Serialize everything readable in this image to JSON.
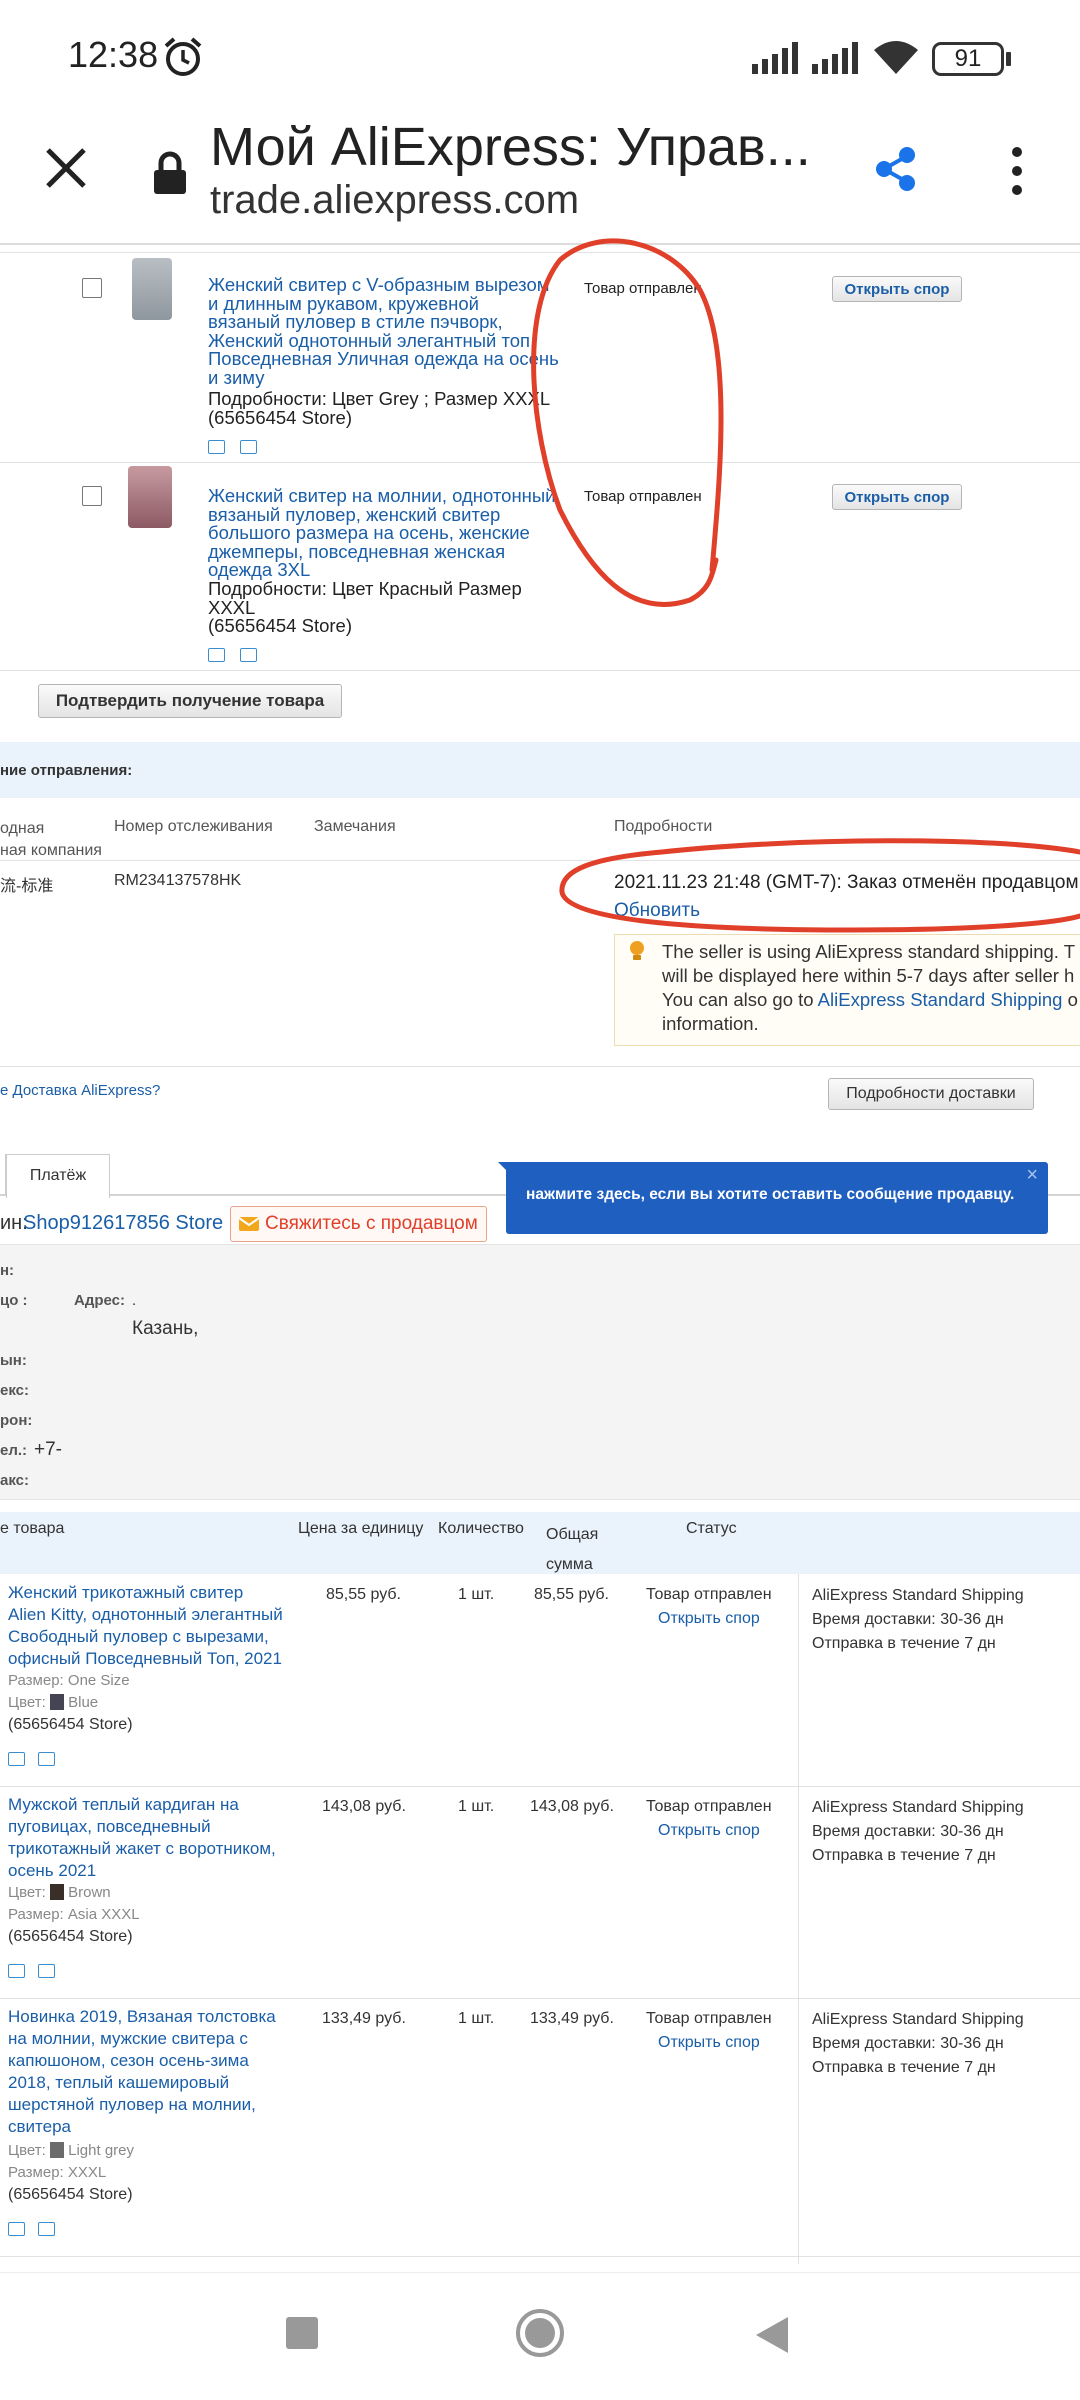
{
  "status_bar": {
    "time": "12:38",
    "battery": "91"
  },
  "browser": {
    "title": "Мой AliExpress: Управ...",
    "url": "trade.aliexpress.com"
  },
  "order_items_top": [
    {
      "title_lines": [
        "Женский свитер с V-образным вырезом",
        "и длинным рукавом, кружевной",
        "вязаный пуловер в стиле пэчворк,",
        "Женский однотонный элегантный топ,",
        "Повседневная Уличная одежда на осень",
        "и зиму"
      ],
      "details_lines": [
        "Подробности: Цвет Grey   ; Размер XXXL",
        "(65656454 Store)"
      ],
      "status": "Товар отправлен",
      "dispute": "Открыть спор"
    },
    {
      "title_lines": [
        "Женский свитер на молнии, однотонный",
        "вязаный пуловер, женский свитер",
        "большого размера на осень, женские",
        "джемперы, повседневная женская",
        "одежда 3XL"
      ],
      "details_lines": [
        "Подробности: Цвет Красный Размер",
        "XXXL",
        "(65656454 Store)"
      ],
      "status": "Товар отправлен",
      "dispute": "Открыть спор"
    }
  ],
  "confirm_button": "Подтвердить получение товара",
  "shipping": {
    "header": "ние отправления:",
    "col_company_1": "одная",
    "col_company_2": "ная компания",
    "col_tracking": "Номер отслеживания",
    "col_remarks": "Замечания",
    "col_details": "Подробности",
    "company": "流-标准",
    "tracking_number": "RM234137578HK",
    "event": "2021.11.23 21:48 (GMT-7): Заказ отменён продавцом",
    "refresh": "Обновить",
    "notice_lines": [
      "The seller is using AliExpress standard shipping. T",
      "will be displayed here within 5-7 days after seller h",
      "information."
    ],
    "notice_line3_pre": "You can also go to ",
    "notice_line3_link": "AliExpress Standard Shipping",
    "notice_line3_post": " o",
    "question_link": "е Доставка AliExpress?",
    "details_button": "Подробности доставки"
  },
  "tabs": {
    "payment": "Платёж"
  },
  "tooltip": {
    "text": "нажмите здесь, если вы хотите оставить сообщение продавцу.",
    "close": "×"
  },
  "store": {
    "label": "ин:",
    "name": "Shop912617856 Store",
    "contact": "Свяжитесь с продавцом"
  },
  "address": {
    "r1": "н:",
    "r2": "цо :",
    "addr_label": "Адрес:",
    "addr_value": ".",
    "city": "Казань,",
    "r3": "ын:",
    "r4": "екс:",
    "r5": "рон:",
    "r6": "ел.:",
    "r6_value": "+7-",
    "r7": "акс:"
  },
  "table": {
    "h_product": "е товара",
    "h_price": "Цена за единицу",
    "h_qty": "Количество",
    "h_total_1": "Общая",
    "h_total_2": "сумма",
    "h_status": "Статус",
    "rows": [
      {
        "title_lines": [
          "Женский трикотажный свитер",
          "Alien Kitty, однотонный элегантный",
          "Свободный пуловер с вырезами,",
          "офисный Повседневный Топ, 2021"
        ],
        "attr1_label": "Размер:",
        "attr1_value": "One Size",
        "attr2_label": "Цвет:",
        "attr2_value": "Blue",
        "store": "(65656454 Store)",
        "price": "85,55 руб.",
        "qty": "1 шт.",
        "total": "85,55 руб.",
        "status": "Товар отправлен",
        "dispute": "Открыть спор",
        "ship1": "AliExpress Standard Shipping",
        "ship2": "Время доставки: 30-36 дн",
        "ship3": "Отправка в течение  7 дн"
      },
      {
        "title_lines": [
          "Мужской теплый кардиган на",
          "пуговицах, повседневный",
          "трикотажный жакет с воротником,",
          "осень 2021"
        ],
        "attr1_label": "Цвет:",
        "attr1_value": "Brown",
        "attr2_label": "Размер:",
        "attr2_value": "Asia XXXL",
        "store": "(65656454 Store)",
        "price": "143,08 руб.",
        "qty": "1 шт.",
        "total": "143,08 руб.",
        "status": "Товар отправлен",
        "dispute": "Открыть спор",
        "ship1": "AliExpress Standard Shipping",
        "ship2": "Время доставки: 30-36 дн",
        "ship3": "Отправка в течение  7 дн"
      },
      {
        "title_lines": [
          "Новинка 2019, Вязаная толстовка",
          "на молнии, мужские свитера с",
          "капюшоном, сезон осень-зима",
          "2018, теплый кашемировый",
          "шерстяной пуловер на молнии,",
          "свитера"
        ],
        "attr1_label": "Цвет:",
        "attr1_value": "Light grey",
        "attr2_label": "Размер:",
        "attr2_value": "XXXL",
        "store": "(65656454 Store)",
        "price": "133,49 руб.",
        "qty": "1 шт.",
        "total": "133,49 руб.",
        "status": "Товар отправлен",
        "dispute": "Открыть спор",
        "ship1": "AliExpress Standard Shipping",
        "ship2": "Время доставки: 30-36 дн",
        "ship3": "Отправка в течение  7 дн"
      }
    ]
  },
  "colors": {
    "link": "#1a5ea8",
    "tooltip": "#1f5fbf",
    "annotation": "#e0402a",
    "share": "#1a73e8"
  },
  "icons": [
    "alarm-icon",
    "signal-icon",
    "wifi-icon",
    "battery-icon",
    "close-icon",
    "lock-icon",
    "share-icon",
    "more-icon",
    "truck-icon",
    "card-icon",
    "lightbulb-icon",
    "mail-icon",
    "square-icon",
    "circle-icon",
    "back-icon"
  ]
}
